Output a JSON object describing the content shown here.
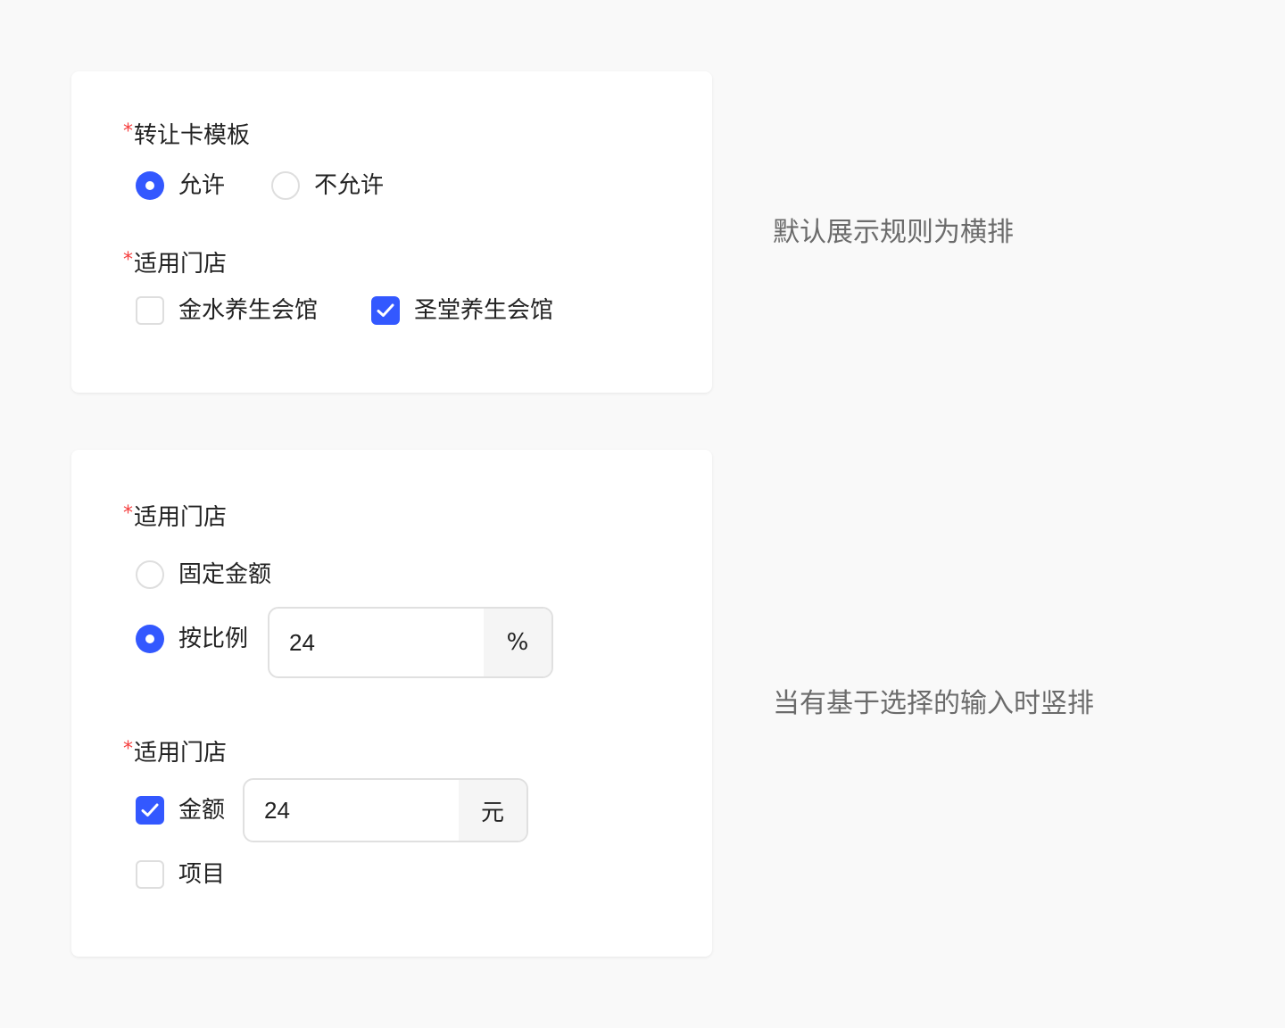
{
  "section1": {
    "field1": {
      "required_mark": "*",
      "label": "转让卡模板",
      "options": [
        {
          "label": "允许",
          "checked": true
        },
        {
          "label": "不允许",
          "checked": false
        }
      ]
    },
    "field2": {
      "required_mark": "*",
      "label": "适用门店",
      "options": [
        {
          "label": "金水养生会馆",
          "checked": false
        },
        {
          "label": "圣堂养生会馆",
          "checked": true
        }
      ]
    },
    "note": "默认展示规则为横排"
  },
  "section2": {
    "field1": {
      "required_mark": "*",
      "label": "适用门店",
      "options": [
        {
          "label": "固定金额",
          "checked": false
        },
        {
          "label": "按比例",
          "checked": true,
          "input_value": "24",
          "suffix": "%"
        }
      ]
    },
    "field2": {
      "required_mark": "*",
      "label": "适用门店",
      "options": [
        {
          "label": "金额",
          "checked": true,
          "input_value": "24",
          "suffix": "元"
        },
        {
          "label": "项目",
          "checked": false
        }
      ]
    },
    "note": "当有基于选择的输入时竖排"
  },
  "colors": {
    "accent": "#3358ff",
    "required": "#f53f3f",
    "background": "#f9f9f9",
    "card": "#ffffff",
    "note_text": "#6b6b6b"
  }
}
